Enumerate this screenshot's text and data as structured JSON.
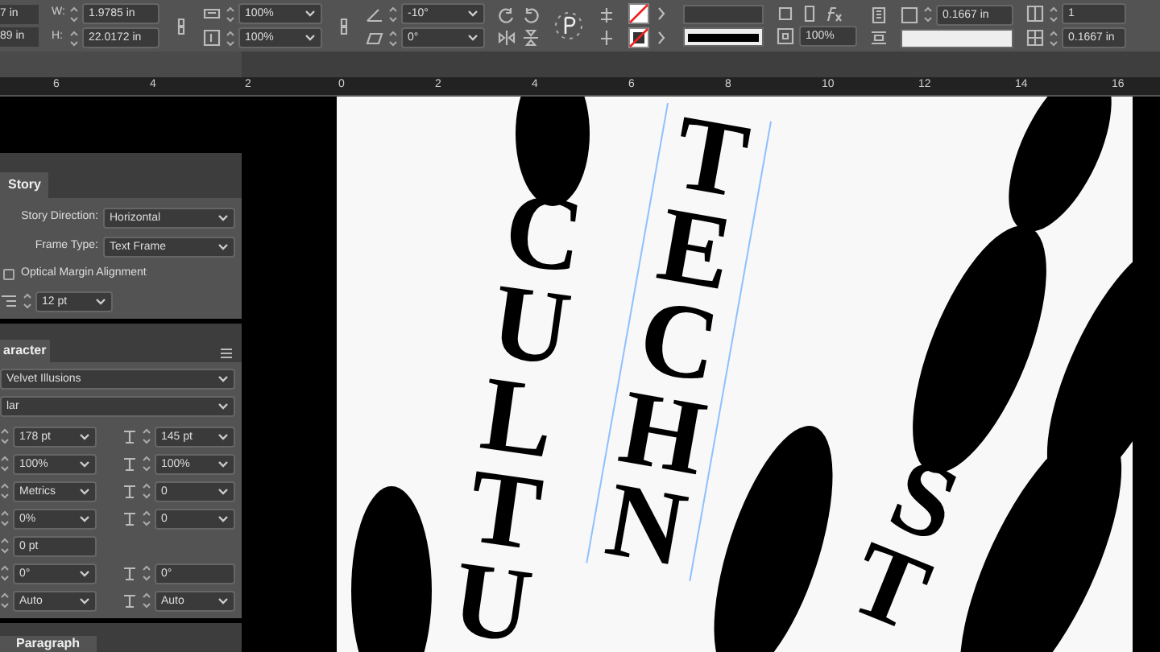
{
  "control_bar": {
    "reference": [
      "7 in",
      "89 in"
    ],
    "size": [
      {
        "label": "W:",
        "value": "1.9785 in"
      },
      {
        "label": "H:",
        "value": "22.0172 in"
      }
    ],
    "scale": [
      "100%",
      "100%"
    ],
    "angles": [
      "-10°",
      "0°"
    ],
    "opacity": "100%",
    "spacing": [
      "0.1667 in",
      "0.1667 in"
    ],
    "columns": "1"
  },
  "ruler": {
    "ticks": [
      "6",
      "4",
      "2",
      "0",
      "2",
      "4",
      "6",
      "8",
      "10",
      "12",
      "14",
      "16"
    ]
  },
  "story_panel": {
    "tab": "Story",
    "direction_label": "Story Direction:",
    "direction": "Horizontal",
    "frame_label": "Frame Type:",
    "frame_type": "Text Frame",
    "optical_margin": {
      "label": "Optical Margin Alignment",
      "checked": false
    },
    "size": "12 pt"
  },
  "character_panel": {
    "tab": "aracter",
    "font": "Velvet Illusions",
    "style": "lar",
    "rows": [
      [
        "178 pt",
        "145 pt"
      ],
      [
        "100%",
        "100%"
      ],
      [
        "Metrics",
        "0"
      ],
      [
        "0%",
        "0"
      ],
      [
        "0 pt"
      ],
      [
        "0°",
        "0°"
      ],
      [
        "Auto",
        "Auto"
      ]
    ]
  },
  "paragraph_panel": {
    "tab": "Paragraph"
  },
  "artwork": {
    "words": [
      "CULTU",
      "TECHN",
      "ST"
    ]
  }
}
